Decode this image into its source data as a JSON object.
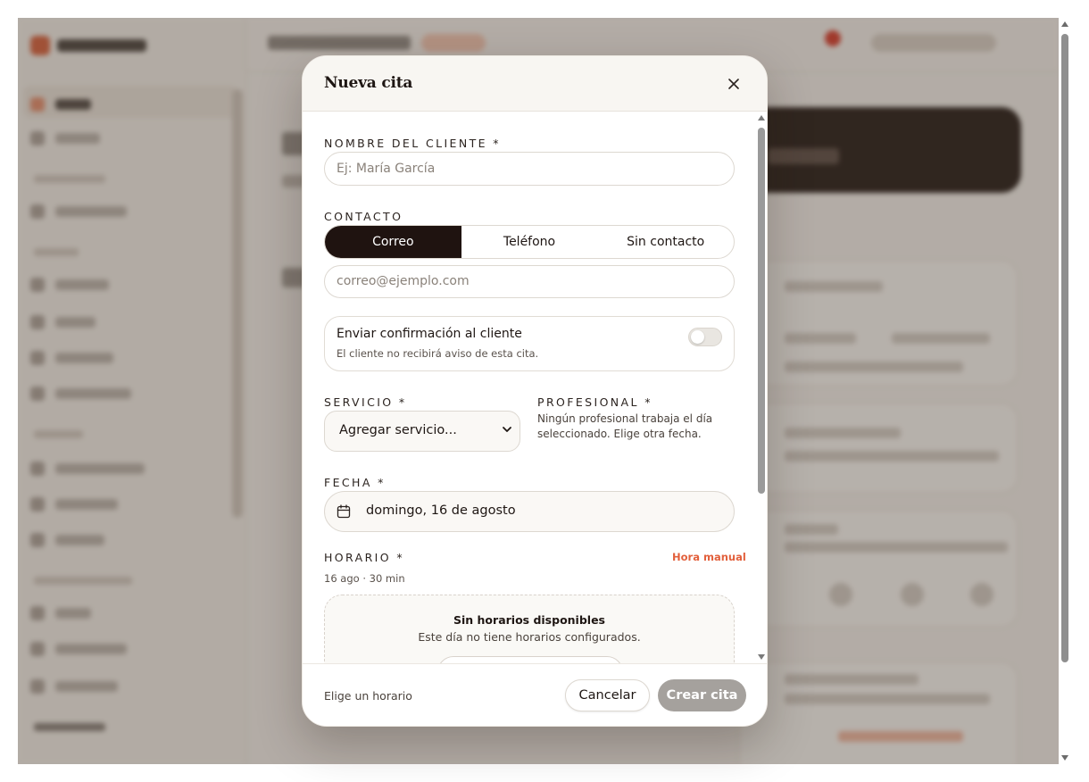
{
  "modal": {
    "title": "Nueva cita",
    "close_icon": "close-icon",
    "client_name": {
      "label": "NOMBRE DEL CLIENTE *",
      "placeholder": "Ej: María García",
      "value": ""
    },
    "contact": {
      "label": "CONTACTO",
      "options": [
        "Correo",
        "Teléfono",
        "Sin contacto"
      ],
      "selected": "Correo",
      "email_placeholder": "correo@ejemplo.com"
    },
    "confirmation": {
      "title": "Enviar confirmación al cliente",
      "subtitle": "El cliente no recibirá aviso de esta cita.",
      "enabled": false
    },
    "service": {
      "label": "SERVICIO *",
      "selected": "Agregar servicio..."
    },
    "professional": {
      "label": "PROFESIONAL *",
      "note": "Ningún profesional trabaja el día seleccionado. Elige otra fecha."
    },
    "date": {
      "label": "FECHA *",
      "value": "domingo, 16 de agosto",
      "icon": "calendar-icon"
    },
    "schedule": {
      "label": "HORARIO *",
      "manual_link": "Hora manual",
      "summary": "16 ago · 30 min",
      "empty_title": "Sin horarios disponibles",
      "empty_subtitle": "Este día no tiene horarios configurados."
    },
    "footer": {
      "hint": "Elige un horario",
      "cancel_label": "Cancelar",
      "create_label": "Crear cita"
    }
  },
  "colors": {
    "accent_dark": "#1f1310",
    "link_orange": "#e2603c",
    "disabled_button": "#a5a19d",
    "overlay": "rgba(70,58,48,0.38)"
  }
}
